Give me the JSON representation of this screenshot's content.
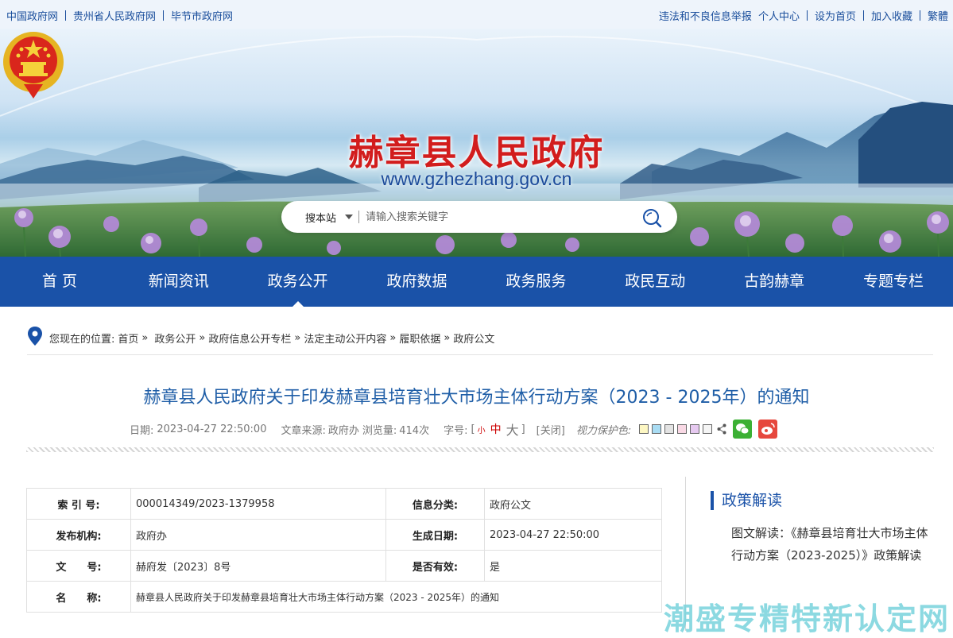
{
  "topbar": {
    "left_links": [
      "中国政府网",
      "贵州省人民政府网",
      "毕节市政府网"
    ],
    "right_links": [
      "违法和不良信息举报",
      "个人中心",
      "设为首页",
      "加入收藏",
      "繁體"
    ]
  },
  "header": {
    "site_title": "赫章县人民政府",
    "site_url": "www.gzhezhang.gov.cn"
  },
  "search": {
    "scope": "搜本站",
    "placeholder": "请输入搜索关键字"
  },
  "nav": {
    "items": [
      "首 页",
      "新闻资讯",
      "政务公开",
      "政府数据",
      "政务服务",
      "政民互动",
      "古韵赫章",
      "专题专栏"
    ],
    "active": "政务公开"
  },
  "breadcrumb": {
    "prefix": "您现在的位置:",
    "items": [
      "首页",
      "政务公开",
      "政府信息公开专栏",
      "法定主动公开内容",
      "履职依据",
      "政府公文"
    ],
    "separator": "»"
  },
  "article": {
    "title": "赫章县人民政府关于印发赫章县培育壮大市场主体行动方案（2023 - 2025年）的通知",
    "date_label": "日期:",
    "date": "2023-04-27 22:50:00",
    "source_label": "文章来源:",
    "source": "政府办",
    "views_label": "浏览量:",
    "views": "414次",
    "fontsize_label": "字号:",
    "fontsize_small": "小",
    "fontsize_medium": "中",
    "fontsize_large": "大",
    "close_label": "[关闭]",
    "eye_label": "视力保护色:",
    "eye_colors": [
      "#fdf7c3",
      "#a9dcf3",
      "#e3e3e3",
      "#f9d9e5",
      "#e6c9f0",
      "#f5f5f5"
    ]
  },
  "info": {
    "index_label": "索 引 号:",
    "index_value": "000014349/2023-1379958",
    "category_label": "信息分类:",
    "category_value": "政府公文",
    "publisher_label": "发布机构:",
    "publisher_value": "政府办",
    "created_label": "生成日期:",
    "created_value": "2023-04-27 22:50:00",
    "docno_label": "文　　号:",
    "docno_value": "赫府发〔2023〕8号",
    "valid_label": "是否有效:",
    "valid_value": "是",
    "name_label": "名　　称:",
    "name_value": "赫章县人民政府关于印发赫章县培育壮大市场主体行动方案（2023 - 2025年）的通知"
  },
  "sidebar": {
    "heading": "政策解读",
    "link": "图文解读：《赫章县培育壮大市场主体行动方案（2023-2025）》政策解读"
  },
  "watermark": "潮盛专精特新认定网",
  "colors": {
    "nav_bg": "#1a52a8",
    "title_red": "#d21d1d",
    "article_title": "#1f5ea7"
  }
}
